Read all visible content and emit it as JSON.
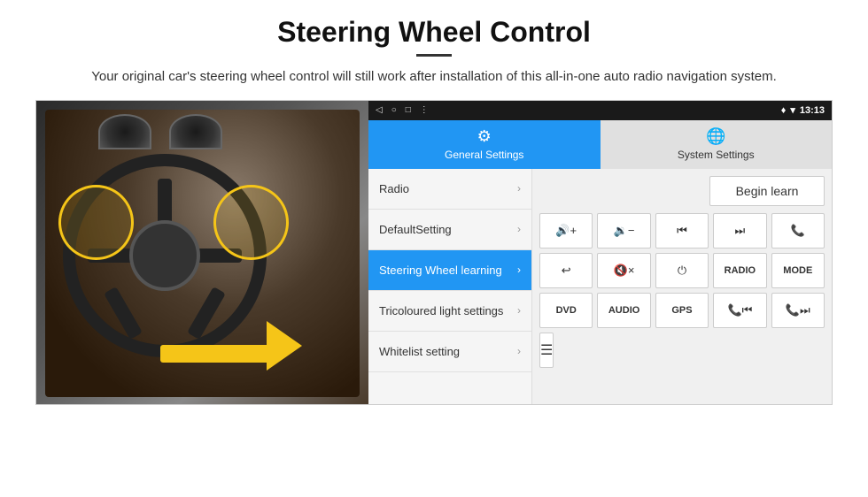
{
  "header": {
    "title": "Steering Wheel Control",
    "subtitle": "Your original car's steering wheel control will still work after installation of this all-in-one auto radio navigation system.",
    "divider": true
  },
  "status_bar": {
    "back_icon": "◁",
    "circle_icon": "○",
    "square_icon": "□",
    "dots_icon": "⋮",
    "location_icon": "♦",
    "wifi_icon": "▾",
    "time": "13:13"
  },
  "tabs": [
    {
      "id": "general",
      "label": "General Settings",
      "icon": "⚙",
      "active": true
    },
    {
      "id": "system",
      "label": "System Settings",
      "icon": "🌐",
      "active": false
    }
  ],
  "menu": {
    "items": [
      {
        "id": "radio",
        "label": "Radio",
        "active": false
      },
      {
        "id": "default-setting",
        "label": "DefaultSetting",
        "active": false
      },
      {
        "id": "steering-wheel",
        "label": "Steering Wheel learning",
        "active": true
      },
      {
        "id": "tricoloured",
        "label": "Tricoloured light settings",
        "active": false
      },
      {
        "id": "whitelist",
        "label": "Whitelist setting",
        "active": false
      }
    ]
  },
  "controls": {
    "begin_learn_label": "Begin learn",
    "buttons_row1": [
      {
        "id": "vol-up",
        "label": "🔊+",
        "unicode": "🔊+"
      },
      {
        "id": "vol-down",
        "label": "🔉−",
        "unicode": "🔉−"
      },
      {
        "id": "prev-track",
        "label": "⏮",
        "unicode": "⏮"
      },
      {
        "id": "next-track",
        "label": "⏭",
        "unicode": "⏭"
      },
      {
        "id": "phone",
        "label": "📞",
        "unicode": "📞"
      }
    ],
    "buttons_row2": [
      {
        "id": "hang-up",
        "label": "↩",
        "unicode": "↩"
      },
      {
        "id": "mute",
        "label": "🔇x",
        "unicode": "🔇×"
      },
      {
        "id": "power",
        "label": "⏻",
        "unicode": "⏻"
      },
      {
        "id": "radio-btn",
        "label": "RADIO",
        "unicode": "RADIO"
      },
      {
        "id": "mode-btn",
        "label": "MODE",
        "unicode": "MODE"
      }
    ],
    "buttons_row3": [
      {
        "id": "dvd-btn",
        "label": "DVD",
        "unicode": "DVD"
      },
      {
        "id": "audio-btn",
        "label": "AUDIO",
        "unicode": "AUDIO"
      },
      {
        "id": "gps-btn",
        "label": "GPS",
        "unicode": "GPS"
      },
      {
        "id": "tel-prev",
        "label": "📞⏮",
        "unicode": "📞⏮"
      },
      {
        "id": "tel-next",
        "label": "📞⏭",
        "unicode": "📞⏭"
      }
    ],
    "whitelist_icon": "☰"
  }
}
